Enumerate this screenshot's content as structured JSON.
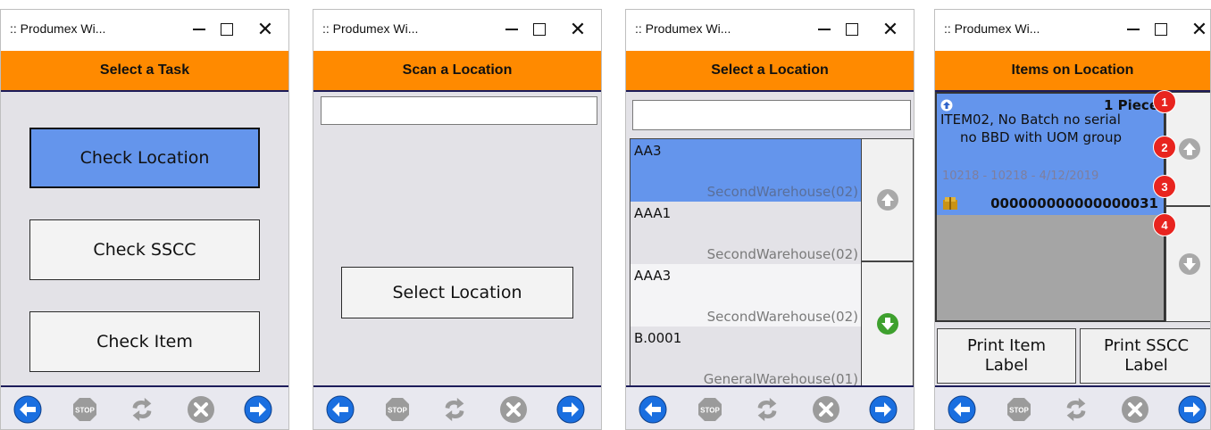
{
  "window_title": ":: Produmex Wi...",
  "window_controls": {
    "minimize": "—",
    "maximize": "☐",
    "close": "✕"
  },
  "colors": {
    "header": "#ff8a00",
    "selection": "#6495ec",
    "content_bg": "#e3e2e7",
    "badge": "#e8241f",
    "nav_blue": "#1a6fe0",
    "nav_green": "#3ea02e",
    "nav_gray": "#9b9b9b"
  },
  "nav_icons": [
    "back-arrow-icon",
    "stop-icon",
    "refresh-icon",
    "cancel-icon",
    "forward-arrow-icon"
  ],
  "screens": [
    {
      "header": "Select a Task",
      "buttons": [
        "Check Location",
        "Check SSCC",
        "Check Item"
      ],
      "selected_button": "Check Location"
    },
    {
      "header": "Scan a Location",
      "input_value": "",
      "button": "Select Location"
    },
    {
      "header": "Select a Location",
      "input_value": "",
      "locations": [
        {
          "name": "AA3",
          "warehouse": "SecondWarehouse(02)"
        },
        {
          "name": "AAA1",
          "warehouse": "SecondWarehouse(02)"
        },
        {
          "name": "AAA3",
          "warehouse": "SecondWarehouse(02)"
        },
        {
          "name": "B.0001",
          "warehouse": "GeneralWarehouse(01)"
        }
      ],
      "selected_location": "AA3"
    },
    {
      "header": "Items on Location",
      "item": {
        "quantity": "1 Piece",
        "description_line1": "ITEM02, No Batch no serial",
        "description_line2": "no BBD with UOM group",
        "batch_info": "10218 - 10218 - 4/12/2019",
        "sscc": "000000000000000031"
      },
      "print_item_label": [
        "Print Item",
        "Label"
      ],
      "print_sscc_label": [
        "Print SSCC",
        "Label"
      ],
      "badges": [
        "1",
        "2",
        "3",
        "4"
      ]
    }
  ]
}
